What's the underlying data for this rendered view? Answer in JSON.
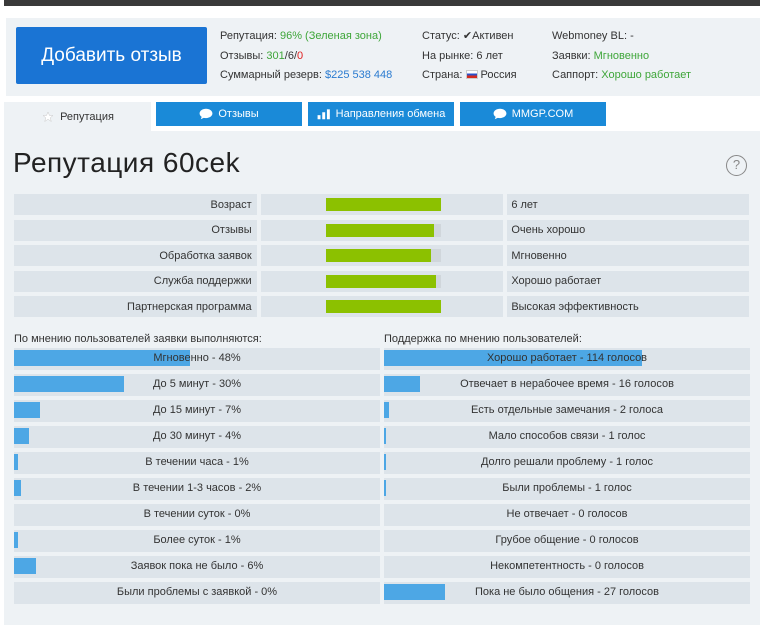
{
  "header": {
    "add_review": "Добавить отзыв",
    "reputation_label": "Репутация:",
    "reputation_value": "96% (Зеленая зона)",
    "reviews_label": "Отзывы:",
    "reviews_pos": "301",
    "reviews_sep1": "/",
    "reviews_neutral": "6",
    "reviews_sep2": "/",
    "reviews_neg": "0",
    "reserve_label": "Суммарный резерв:",
    "reserve_value": "$225 538 448",
    "status_label": "Статус:",
    "status_value": "✔Активен",
    "market_label": "На рынке:",
    "market_value": "6 лет",
    "country_label": "Страна:",
    "country_value": "Россия",
    "wmbl_label": "Webmoney BL:",
    "wmbl_value": "-",
    "requests_label": "Заявки:",
    "requests_value": "Мгновенно",
    "support_label": "Саппорт:",
    "support_value": "Хорошо работает"
  },
  "tabs": [
    {
      "label": "Репутация",
      "icon": "star-icon"
    },
    {
      "label": "Отзывы",
      "icon": "chat-bubble-icon"
    },
    {
      "label": "Направления обмена",
      "icon": "bar-chart-icon"
    },
    {
      "label": "MMGP.COM",
      "icon": "chat-bubble-icon"
    }
  ],
  "page": {
    "title": "Репутация 60cek",
    "help": "?"
  },
  "metrics": [
    {
      "label": "Возраст",
      "fill": 1.0,
      "value": "6 лет"
    },
    {
      "label": "Отзывы",
      "fill": 0.94,
      "value": "Очень хорошо"
    },
    {
      "label": "Обработка заявок",
      "fill": 0.92,
      "value": "Мгновенно"
    },
    {
      "label": "Служба поддержки",
      "fill": 0.96,
      "value": "Хорошо работает"
    },
    {
      "label": "Партнерская программа",
      "fill": 1.0,
      "value": "Высокая эффективность"
    }
  ],
  "left_column": {
    "title": "По мнению пользователей заявки выполняются:",
    "rows": [
      {
        "label": "Мгновенно - 48%",
        "percent": 48
      },
      {
        "label": "До 5 минут - 30%",
        "percent": 30
      },
      {
        "label": "До 15 минут - 7%",
        "percent": 7
      },
      {
        "label": "До 30 минут - 4%",
        "percent": 4
      },
      {
        "label": "В течении часа - 1%",
        "percent": 1
      },
      {
        "label": "В течении 1-3 часов - 2%",
        "percent": 2
      },
      {
        "label": "В течении суток - 0%",
        "percent": 0
      },
      {
        "label": "Более суток - 1%",
        "percent": 1
      },
      {
        "label": "Заявок пока не было - 6%",
        "percent": 6
      },
      {
        "label": "Были проблемы с заявкой - 0%",
        "percent": 0
      }
    ]
  },
  "right_column": {
    "title": "Поддержка по мнению пользователей:",
    "rows": [
      {
        "label": "Хорошо работает - 114 голосов",
        "votes": 114
      },
      {
        "label": "Отвечает в нерабочее время - 16 голосов",
        "votes": 16
      },
      {
        "label": "Есть отдельные замечания - 2 голоса",
        "votes": 2
      },
      {
        "label": "Мало способов связи - 1 голос",
        "votes": 1
      },
      {
        "label": "Долго решали проблему - 1 голос",
        "votes": 1
      },
      {
        "label": "Были проблемы - 1 голос",
        "votes": 1
      },
      {
        "label": "Не отвечает - 0 голосов",
        "votes": 0
      },
      {
        "label": "Грубое общение - 0 голосов",
        "votes": 0
      },
      {
        "label": "Некомпетентность - 0 голосов",
        "votes": 0
      },
      {
        "label": "Пока не было общения - 27 голосов",
        "votes": 27
      }
    ]
  },
  "colors": {
    "accent": "#1a74d4",
    "tab": "#1a8ad8",
    "green_bar": "#8cc100",
    "blue_bar": "#4da7e5",
    "positive_text": "#3fa63a",
    "negative_text": "#e02020"
  }
}
